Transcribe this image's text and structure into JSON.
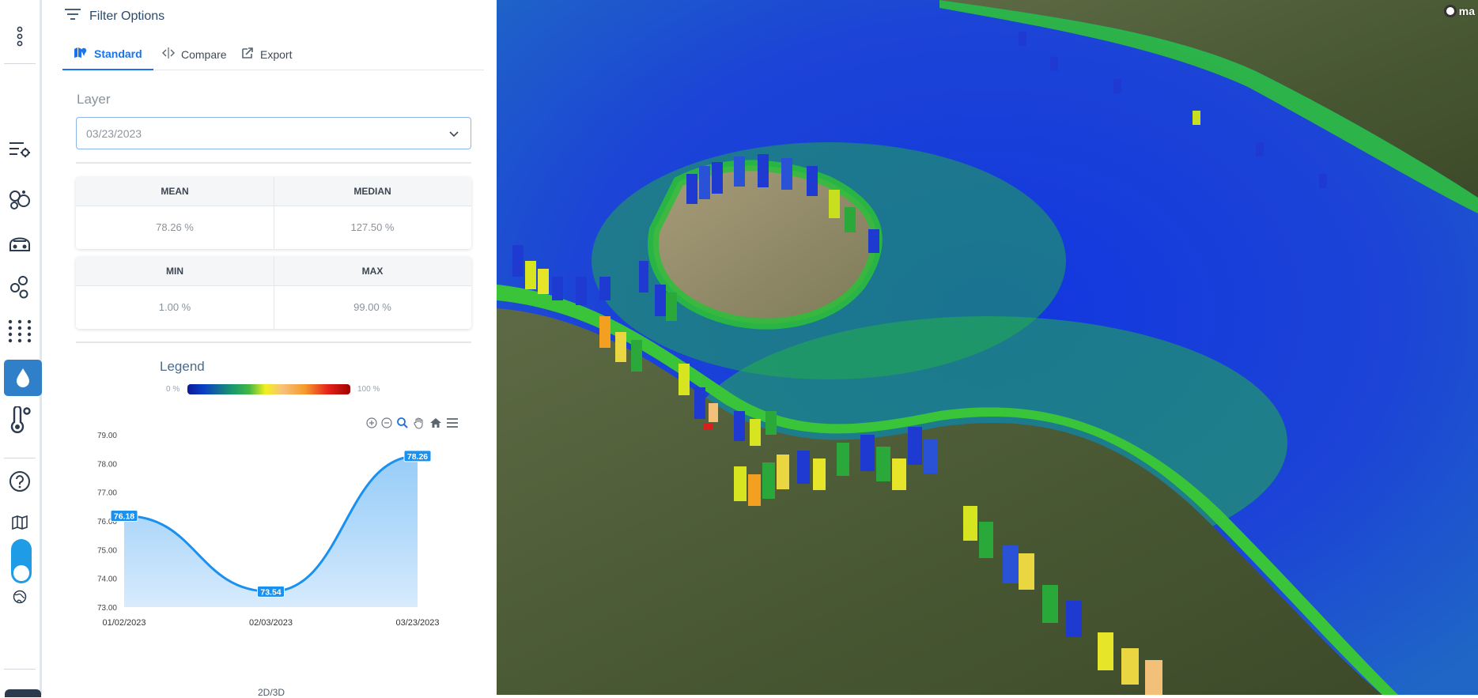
{
  "panel": {
    "title": "Filter Options",
    "tabs": [
      {
        "label": "Standard",
        "icon": "map-marker-icon"
      },
      {
        "label": "Compare",
        "icon": "compare-split-icon"
      },
      {
        "label": "Export",
        "icon": "export-icon"
      }
    ],
    "layer": {
      "label": "Layer",
      "selected": "03/23/2023"
    },
    "stats": {
      "mean": {
        "label": "MEAN",
        "value": "78.26 %"
      },
      "median": {
        "label": "MEDIAN",
        "value": "127.50 %"
      },
      "min": {
        "label": "MIN",
        "value": "1.00 %"
      },
      "max": {
        "label": "MAX",
        "value": "99.00 %"
      }
    },
    "legend": {
      "title": "Legend",
      "min_label": "0 %",
      "max_label": "100 %"
    },
    "footer_label": "2D/3D"
  },
  "rail": {
    "icons": [
      "more-vertical-icon",
      "filter-settings-icon",
      "bubbles-icon",
      "satellite-icon",
      "molecule-icon",
      "dot-grid-icon",
      "water-drop-icon",
      "thermometer-icon",
      "help-icon",
      "map-icon",
      "globe-icon"
    ],
    "active": "water-drop-icon",
    "accent": "#2f80c9",
    "toggle_color": "#1f9ce6"
  },
  "chart_data": {
    "type": "area",
    "x": [
      "01/02/2023",
      "02/03/2023",
      "03/23/2023"
    ],
    "values": [
      76.18,
      73.54,
      78.26
    ],
    "data_labels": [
      "76.18",
      "73.54",
      "78.26"
    ],
    "ylim": [
      73.0,
      79.0
    ],
    "yticks": [
      "73.00",
      "74.00",
      "75.00",
      "76.00",
      "77.00",
      "78.00",
      "79.00"
    ],
    "grid": false,
    "line_color": "#1a90f0",
    "fill_color": "#b9dbfb",
    "toolbar": [
      "zoom-in-icon",
      "zoom-out-icon",
      "zoom-selection-icon",
      "pan-hand-icon",
      "home-icon",
      "menu-icon"
    ]
  },
  "map": {
    "attribution": "ma",
    "water_color": "#1f4bd8",
    "shore_color": "#3cc430"
  }
}
